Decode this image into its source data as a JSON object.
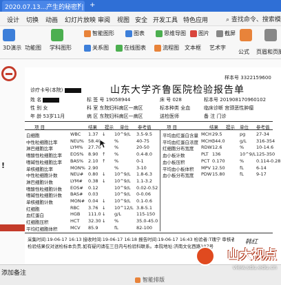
{
  "titlebar": {
    "tab_title": "2020.07.13...产生的秘密) | ",
    "close": "×",
    "new_tab": "+"
  },
  "menu": {
    "items": [
      "设计",
      "切换",
      "动画",
      "幻灯片放映",
      "审阅",
      "视图",
      "安全",
      "开发工具",
      "特色应用"
    ],
    "active": "切换",
    "search": "查找命令、搜索模板"
  },
  "ribbon": {
    "row1": [
      "智能图形",
      "图表",
      "思维导图",
      "图片",
      "截屏"
    ],
    "row2": [
      "3D演示",
      "功能图",
      "学科图形",
      "关系图",
      "在线图表",
      "流程图",
      "文本框",
      "艺术字",
      "公式",
      "页眉和页脚"
    ],
    "colors": {
      "orange": "#e8833a",
      "blue": "#3d7fd9",
      "green": "#4caf50",
      "red": "#d9453d"
    }
  },
  "report": {
    "title": "山东大学齐鲁医院检验报告单",
    "sample_no_label": "样本号",
    "sample_no": "3322159600",
    "outpatient_label": "诊疗卡号(本院)",
    "barcode_label": "标 签 号",
    "barcode": "19058944",
    "bed_label": "床 号",
    "bed": "028",
    "specimen_label": "标本号",
    "specimen": "201908170960102",
    "name_label": "姓 名",
    "sex_label": "性 别",
    "sex": "女",
    "dept_label": "科 室",
    "dept": "东院妇科病区一病区",
    "sample_type_label": "标本种类",
    "sample_type": "全血",
    "clinical_label": "临床诊断",
    "clinical": "宫颈恶性肿瘤",
    "age_label": "年 龄",
    "age": "53岁11月",
    "ward_label": "病 区",
    "ward": "东院妇科病区一病区",
    "doctor_label": "送检医师",
    "remark_label": "备 注",
    "remark": "门诊",
    "cols_left": [
      "项 目",
      "结果",
      "提示",
      "单位",
      "参考值"
    ],
    "cols_right": [
      "项 目",
      "结果",
      "提示",
      "单位",
      "参考值"
    ],
    "left_rows": [
      [
        "白细胞",
        "WBC",
        "1.37",
        "↓",
        "10^9/L",
        "3.5-9.5"
      ],
      [
        "中性粒细胞比率",
        "NEU%",
        "58.40",
        "",
        "%",
        "40-75"
      ],
      [
        "淋巴细胞比率",
        "LYM%",
        "27.70",
        "",
        "%",
        "20-50"
      ],
      [
        "嗜酸性粒细胞比率",
        "EOS%",
        "8.90",
        "↑",
        "%",
        "0.4-8.0"
      ],
      [
        "嗜碱性粒细胞比率",
        "BAS%",
        "2.10",
        "↑",
        "%",
        "0-1"
      ],
      [
        "单核细胞比率",
        "MON%",
        "2.90",
        "",
        "%",
        "3-10"
      ],
      [
        "中性粒细胞计数",
        "NEU#",
        "0.80",
        "↓",
        "10^9/L",
        "1.8-6.3"
      ],
      [
        "淋巴细胞计数",
        "LYM#",
        "0.38",
        "↓",
        "10^9/L",
        "1.1-3.2"
      ],
      [
        "嗜酸性粒细胞计数",
        "EOS#",
        "0.12",
        "",
        "10^9/L",
        "0.02-0.52"
      ],
      [
        "嗜碱性粒细胞计数",
        "BAS#",
        "0.03",
        "",
        "10^9/L",
        "0-0.06"
      ],
      [
        "单核细胞计数",
        "MON#",
        "0.04",
        "↓",
        "10^9/L",
        "0.1-0.6"
      ],
      [
        "红细胞",
        "RBC",
        "3.76",
        "↓",
        "10^12/L",
        "3.8-5.1"
      ],
      [
        "血红蛋白",
        "HGB",
        "111.0",
        "↓",
        "g/L",
        "115-150"
      ],
      [
        "红细胞压积",
        "HCT",
        "32.30",
        "↓",
        "%",
        "35.0-45.0"
      ],
      [
        "平均红细胞体积",
        "MCV",
        "85.9",
        "",
        "fL",
        "82-100"
      ]
    ],
    "right_rows": [
      [
        "平均血红蛋白含量",
        "MCH",
        "29.5",
        "",
        "pg",
        "27-34"
      ],
      [
        "平均血红蛋白浓度",
        "MCHC",
        "344.0",
        "",
        "g/L",
        "316-354"
      ],
      [
        "红细胞分布宽度",
        "RDW",
        "12.6",
        "",
        "%",
        "10-14.6"
      ],
      [
        "血小板计数",
        "PLT",
        "136",
        "",
        "10^9/L",
        "125-350"
      ],
      [
        "血小板压积",
        "PCT",
        "0.170",
        "",
        "%",
        "0.114-0.28"
      ],
      [
        "平均血小板体积",
        "MPV",
        "12.50",
        "",
        "fL",
        "6-14"
      ],
      [
        "血小板分布宽度",
        "PDW",
        "15.80",
        "",
        "fL",
        "9-17"
      ]
    ],
    "footer_left": "采集时间:19-06-17 16:13   接收时间:19-06-17 16:18   报告时间:19-06-17 16:43   检验者:T瑰宁   审核者:",
    "footer_note": "检验结果仅对送检标本负责,如有疑问请在三日内与检验科联系。本院地址:济南文化西路107号",
    "signature": "韩红"
  },
  "status": {
    "note": "添加备注",
    "smart": "智能排版"
  },
  "watermark": {
    "brand": "山大视点",
    "url": "view.sdu.edu.cn"
  }
}
